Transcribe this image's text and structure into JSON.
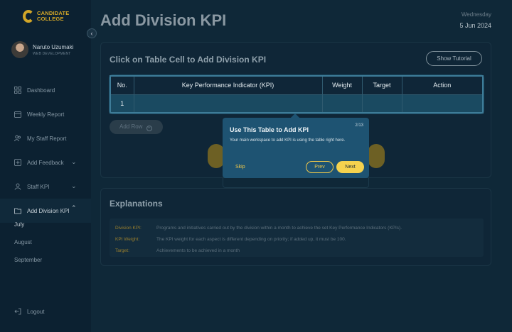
{
  "brand": {
    "line1": "CANDIDATE",
    "line2": "COLLEGE"
  },
  "user": {
    "name": "Naruto Uzumaki",
    "role": "WEB DEVELOPMENT"
  },
  "nav": [
    {
      "label": "Dashboard",
      "icon": "grid-icon"
    },
    {
      "label": "Weekly Report",
      "icon": "calendar-icon"
    },
    {
      "label": "My Staff Report",
      "icon": "users-icon"
    },
    {
      "label": "Add Feedback",
      "icon": "plus-square-icon"
    },
    {
      "label": "Staff KPI",
      "icon": "user-icon"
    },
    {
      "label": "Add Division KPI",
      "icon": "folder-icon"
    }
  ],
  "submenu": [
    "July",
    "August",
    "September"
  ],
  "logout": "Logout",
  "header": {
    "title": "Add Division KPI",
    "day": "Wednesday",
    "date": "5 Jun 2024"
  },
  "table_card": {
    "title": "Click on Table Cell to Add Division KPI",
    "tutorial_button": "Show Tutorial",
    "columns": [
      "No.",
      "Key Performance Indicator (KPI)",
      "Weight",
      "Target",
      "Action"
    ],
    "rows": [
      [
        "1",
        "",
        "",
        "",
        ""
      ]
    ],
    "add_row": "Add Row"
  },
  "explanations": {
    "title": "Explanations",
    "items": [
      {
        "key": "Division KPI:",
        "value": "Programs and initiatives carried out by the division within a month to achieve the set Key Performance Indicators (KPIs)."
      },
      {
        "key": "KPI Weight:",
        "value": "The KPI weight for each aspect is different depending on priority; if added up, it must be 100."
      },
      {
        "key": "Target:",
        "value": "Achievements to be achieved in a month"
      }
    ]
  },
  "tooltip": {
    "title": "Use This Table to Add KPI",
    "step": "2/13",
    "body": "Your main workspace to add KPI is using the table right here.",
    "skip": "Skip",
    "prev": "Prev",
    "next": "Next"
  },
  "colors": {
    "accent": "#f5d24e",
    "brand": "#d2a628",
    "tooltip_bg": "#1e5372"
  }
}
